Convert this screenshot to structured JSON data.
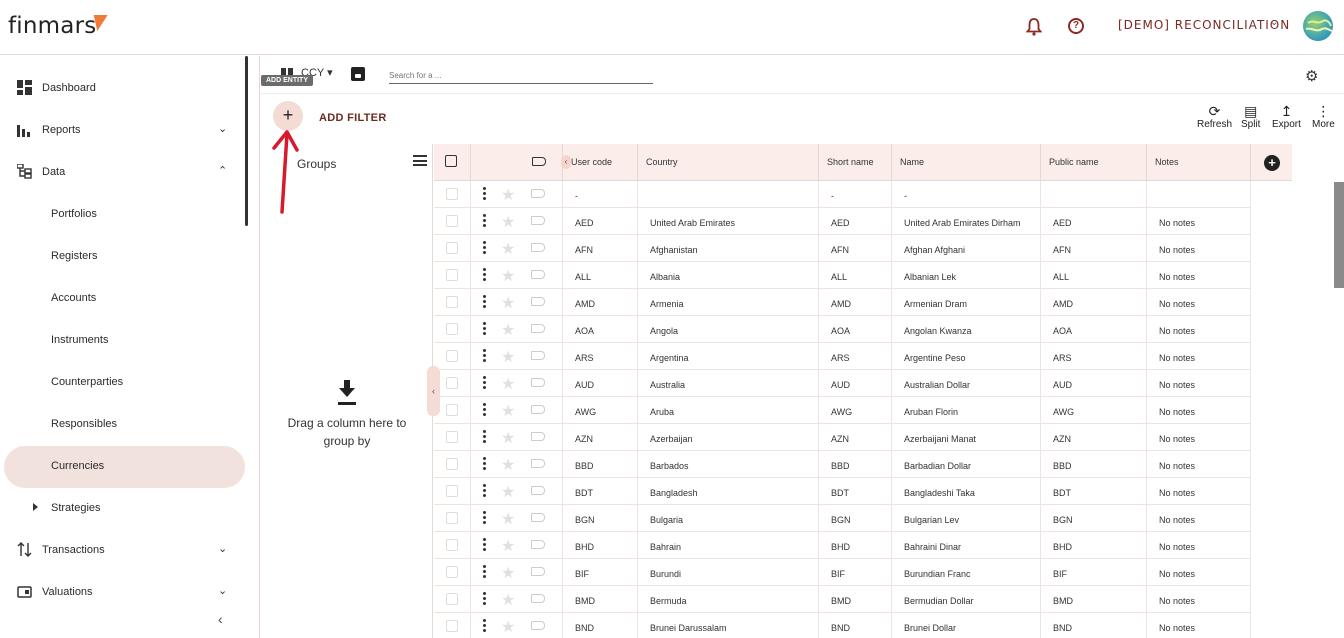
{
  "header": {
    "logo": "finmars",
    "workspace": "[DEMO] RECONCILIATION",
    "icons": [
      "bell-icon",
      "help-icon",
      "chevron-down-icon",
      "avatar"
    ]
  },
  "sidebar": {
    "items": [
      {
        "label": "Dashboard",
        "icon": "dashboard-icon"
      },
      {
        "label": "Reports",
        "icon": "bar-chart-icon"
      },
      {
        "label": "Data",
        "icon": "data-tree-icon"
      },
      {
        "label": "Portfolios"
      },
      {
        "label": "Registers"
      },
      {
        "label": "Accounts"
      },
      {
        "label": "Instruments"
      },
      {
        "label": "Counterparties"
      },
      {
        "label": "Responsibles"
      },
      {
        "label": "Currencies"
      },
      {
        "label": "Strategies"
      },
      {
        "label": "Transactions",
        "icon": "transactions-icon"
      },
      {
        "label": "Valuations",
        "icon": "valuations-icon"
      }
    ]
  },
  "toolbar": {
    "entity": "CCY",
    "search_placeholder": "Search for a ...",
    "tooltip": "ADD ENTITY",
    "add_filter": "ADD FILTER",
    "buttons": [
      "Refresh",
      "Split",
      "Export",
      "More"
    ]
  },
  "groups": {
    "title": "Groups",
    "drop_text": "Drag a column here to group by"
  },
  "table": {
    "columns": [
      "User code",
      "Country",
      "Short name",
      "Name",
      "Public name",
      "Notes"
    ],
    "rows": [
      {
        "user_code": "-",
        "country": "",
        "short_name": "-",
        "name": "-",
        "public_name": "",
        "notes": ""
      },
      {
        "user_code": "AED",
        "country": "United Arab Emirates",
        "short_name": "AED",
        "name": "United Arab Emirates Dirham",
        "public_name": "AED",
        "notes": "No notes"
      },
      {
        "user_code": "AFN",
        "country": "Afghanistan",
        "short_name": "AFN",
        "name": "Afghan Afghani",
        "public_name": "AFN",
        "notes": "No notes"
      },
      {
        "user_code": "ALL",
        "country": "Albania",
        "short_name": "ALL",
        "name": "Albanian Lek",
        "public_name": "ALL",
        "notes": "No notes"
      },
      {
        "user_code": "AMD",
        "country": "Armenia",
        "short_name": "AMD",
        "name": "Armenian Dram",
        "public_name": "AMD",
        "notes": "No notes"
      },
      {
        "user_code": "AOA",
        "country": "Angola",
        "short_name": "AOA",
        "name": "Angolan Kwanza",
        "public_name": "AOA",
        "notes": "No notes"
      },
      {
        "user_code": "ARS",
        "country": "Argentina",
        "short_name": "ARS",
        "name": "Argentine Peso",
        "public_name": "ARS",
        "notes": "No notes"
      },
      {
        "user_code": "AUD",
        "country": "Australia",
        "short_name": "AUD",
        "name": "Australian Dollar",
        "public_name": "AUD",
        "notes": "No notes"
      },
      {
        "user_code": "AWG",
        "country": "Aruba",
        "short_name": "AWG",
        "name": "Aruban Florin",
        "public_name": "AWG",
        "notes": "No notes"
      },
      {
        "user_code": "AZN",
        "country": "Azerbaijan",
        "short_name": "AZN",
        "name": "Azerbaijani Manat",
        "public_name": "AZN",
        "notes": "No notes"
      },
      {
        "user_code": "BBD",
        "country": "Barbados",
        "short_name": "BBD",
        "name": "Barbadian Dollar",
        "public_name": "BBD",
        "notes": "No notes"
      },
      {
        "user_code": "BDT",
        "country": "Bangladesh",
        "short_name": "BDT",
        "name": "Bangladeshi Taka",
        "public_name": "BDT",
        "notes": "No notes"
      },
      {
        "user_code": "BGN",
        "country": "Bulgaria",
        "short_name": "BGN",
        "name": "Bulgarian Lev",
        "public_name": "BGN",
        "notes": "No notes"
      },
      {
        "user_code": "BHD",
        "country": "Bahrain",
        "short_name": "BHD",
        "name": "Bahraini Dinar",
        "public_name": "BHD",
        "notes": "No notes"
      },
      {
        "user_code": "BIF",
        "country": "Burundi",
        "short_name": "BIF",
        "name": "Burundian Franc",
        "public_name": "BIF",
        "notes": "No notes"
      },
      {
        "user_code": "BMD",
        "country": "Bermuda",
        "short_name": "BMD",
        "name": "Bermudian Dollar",
        "public_name": "BMD",
        "notes": "No notes"
      },
      {
        "user_code": "BND",
        "country": "Brunei Darussalam",
        "short_name": "BND",
        "name": "Brunei Dollar",
        "public_name": "BND",
        "notes": "No notes"
      }
    ]
  },
  "colors": {
    "accent": "#7a2a22",
    "active_bg": "#f2e2dd",
    "header_bg": "#fbeeea",
    "annotation_arrow": "#d81b2c"
  }
}
